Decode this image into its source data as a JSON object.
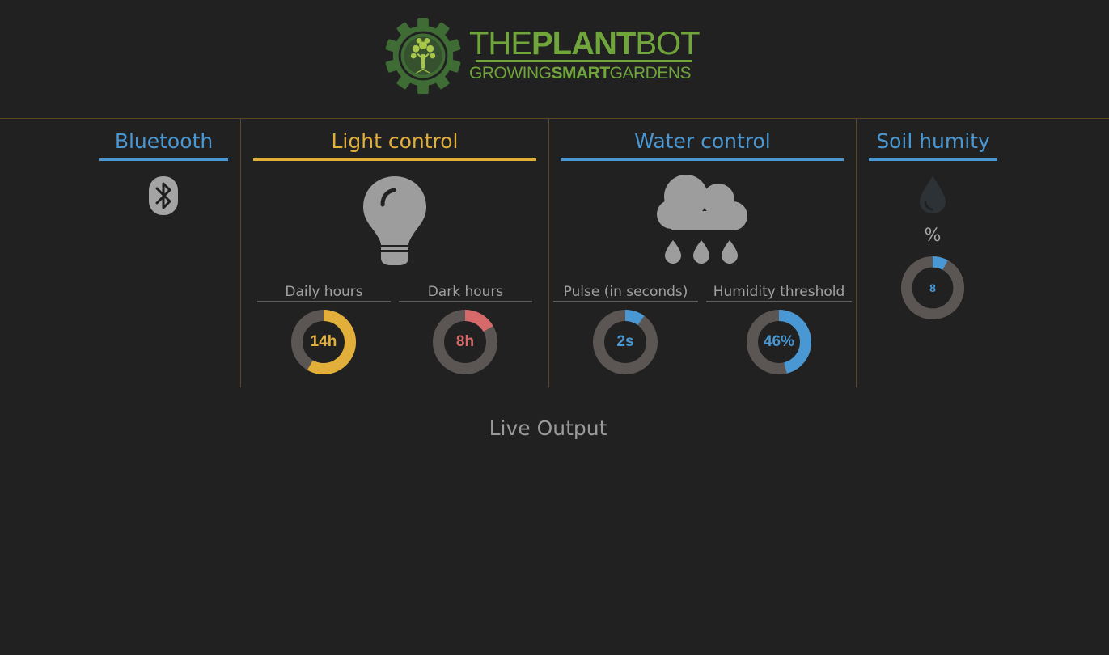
{
  "logo": {
    "title_the": "THE",
    "title_plant": "PLANT",
    "title_bot": "BOT",
    "sub_growing": "GROWING",
    "sub_smart": "SMART",
    "sub_gardens": "GARDENS",
    "icon": "tree-gear-icon"
  },
  "colors": {
    "background": "#212121",
    "brand_green": "#6fa53a",
    "blue": "#4a98d3",
    "gold": "#e2b03a",
    "red": "#d66a6a",
    "track": "#5b5654"
  },
  "sections": {
    "bluetooth": {
      "title": "Bluetooth",
      "icon": "bluetooth-icon"
    },
    "light": {
      "title": "Light control",
      "icon": "light-bulb-icon",
      "daily_label": "Daily hours",
      "daily_value": "14h",
      "daily_fraction": 0.5833,
      "dark_label": "Dark hours",
      "dark_value": "8h",
      "dark_fraction": 0.1667
    },
    "water": {
      "title": "Water control",
      "icon": "rain-cloud-icon",
      "pulse_label": "Pulse (in seconds)",
      "pulse_value": "2s",
      "pulse_fraction": 0.1,
      "humidity_label": "Humidity threshold",
      "humidity_value": "46%",
      "humidity_fraction": 0.46
    },
    "soil": {
      "title": "Soil humity",
      "icon": "water-drop-icon",
      "unit": "%",
      "value": "8",
      "fraction": 0.08
    }
  },
  "live_output": {
    "title": "Live Output"
  }
}
